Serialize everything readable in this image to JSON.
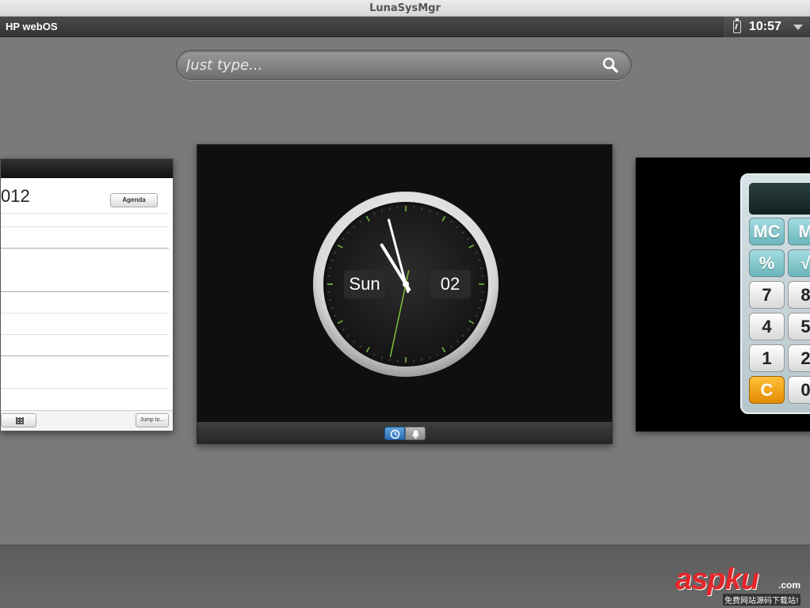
{
  "window": {
    "title": "LunaSysMgr"
  },
  "statusbar": {
    "brand": "HP webOS",
    "time": "10:57"
  },
  "search": {
    "placeholder": "Just type..."
  },
  "calendar_card": {
    "year_fragment": "012",
    "agenda_label": "Agenda",
    "jump_label": "Jump to..."
  },
  "clock_card": {
    "day": "Sun",
    "date": "02",
    "hands": {
      "hour": 10,
      "minute": 57,
      "second": 32
    }
  },
  "calculator_card": {
    "keys": [
      {
        "label": "MC",
        "style": "teal"
      },
      {
        "label": "M",
        "style": "teal"
      },
      {
        "label": "%",
        "style": "teal"
      },
      {
        "label": "√",
        "style": "teal"
      },
      {
        "label": "7",
        "style": "white"
      },
      {
        "label": "8",
        "style": "white"
      },
      {
        "label": "4",
        "style": "white"
      },
      {
        "label": "5",
        "style": "white"
      },
      {
        "label": "1",
        "style": "white"
      },
      {
        "label": "2",
        "style": "white"
      },
      {
        "label": "C",
        "style": "orange"
      },
      {
        "label": "0",
        "style": "white"
      }
    ]
  },
  "watermark": {
    "brand": "aspku",
    "tld": ".com",
    "tagline": "免费网站源码下载站!"
  },
  "colors": {
    "accent_blue": "#3d86cc",
    "second_hand": "#7cc23a",
    "calc_teal": "#86c8ce",
    "calc_orange": "#f0a010"
  }
}
